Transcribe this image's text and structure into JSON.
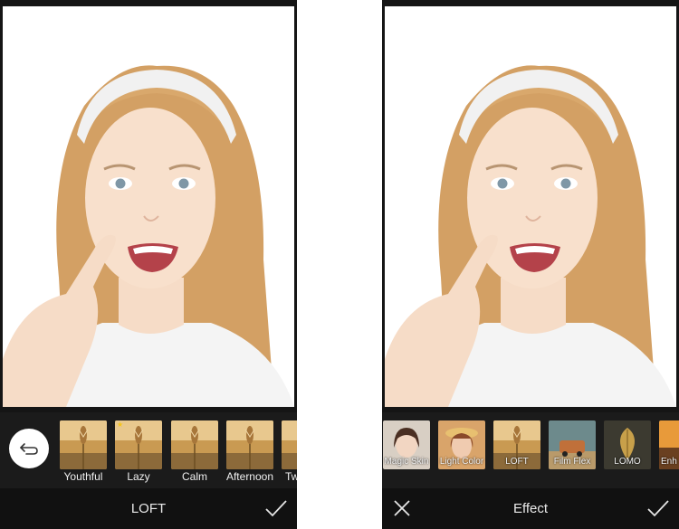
{
  "left_screen": {
    "undo_icon": "undo-arrow-icon",
    "filters": [
      {
        "label": "Youthful",
        "favorite": false
      },
      {
        "label": "Lazy",
        "favorite": true
      },
      {
        "label": "Calm",
        "favorite": false
      },
      {
        "label": "Afternoon",
        "favorite": false
      },
      {
        "label": "Tw",
        "favorite": false
      }
    ],
    "bottom_title": "LOFT",
    "confirm_icon": "checkmark-icon"
  },
  "right_screen": {
    "effects": [
      {
        "label": "Magic Skin"
      },
      {
        "label": "Light Color"
      },
      {
        "label": "LOFT"
      },
      {
        "label": "Film Flex"
      },
      {
        "label": "LOMO"
      },
      {
        "label": "Enh"
      }
    ],
    "bottom_title": "Effect",
    "close_icon": "close-icon",
    "confirm_icon": "checkmark-icon"
  },
  "colors": {
    "bar_bg": "#111111",
    "strip_bg": "#1b1b1b",
    "favorite_star": "#f5c518"
  }
}
